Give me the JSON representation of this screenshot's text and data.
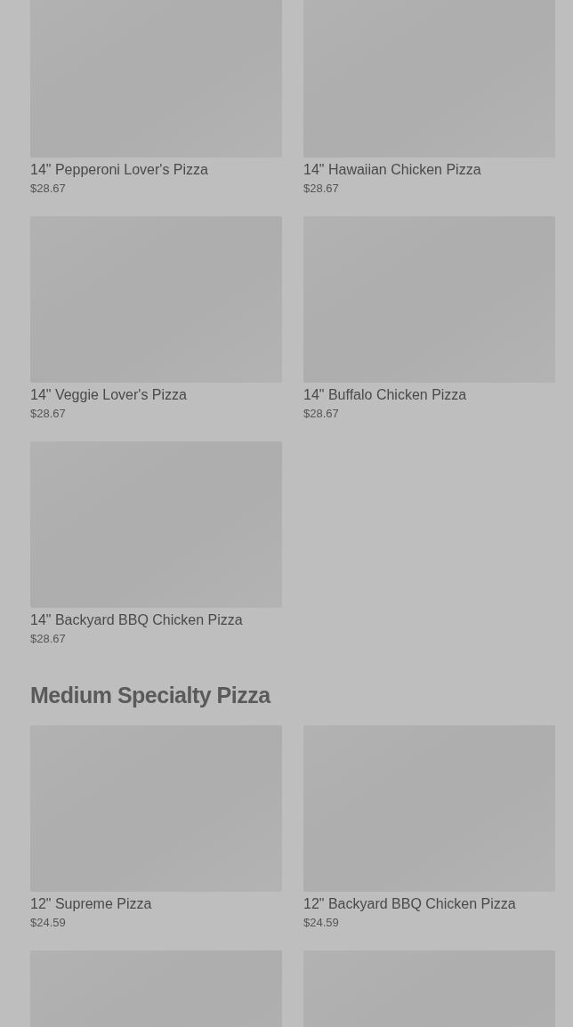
{
  "sections": [
    {
      "items": [
        {
          "kind": "product",
          "name": "14\" Pepperoni Lover's Pizza",
          "price": "$28.67"
        },
        {
          "kind": "product",
          "name": "14\" Hawaiian Chicken Pizza",
          "price": "$28.67"
        },
        {
          "kind": "product",
          "name": "14\" Veggie Lover's Pizza",
          "price": "$28.67"
        },
        {
          "kind": "product",
          "name": "14\" Buffalo Chicken Pizza",
          "price": "$28.67"
        },
        {
          "kind": "product",
          "name": "14\" Backyard BBQ Chicken Pizza",
          "price": "$28.67"
        }
      ]
    },
    {
      "title": "Medium Specialty Pizza",
      "items": [
        {
          "kind": "product",
          "name": "12\" Supreme Pizza",
          "price": "$24.59"
        },
        {
          "kind": "product",
          "name": "12\" Backyard BBQ Chicken Pizza",
          "price": "$24.59"
        },
        {
          "kind": "image_only"
        },
        {
          "kind": "image_only"
        }
      ]
    }
  ]
}
